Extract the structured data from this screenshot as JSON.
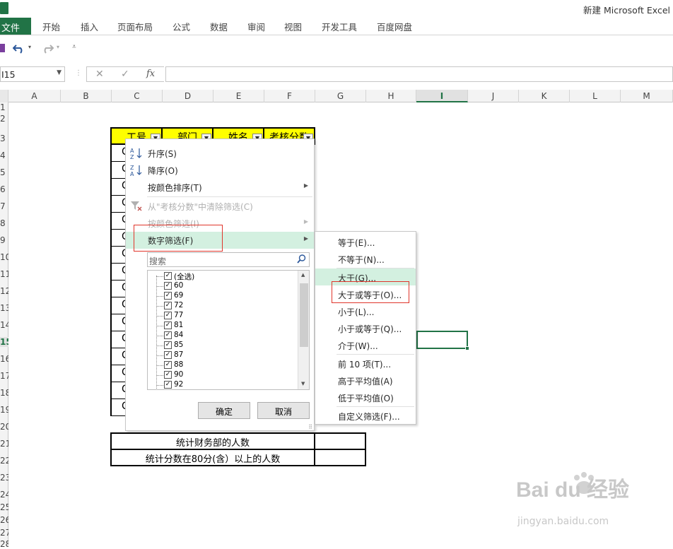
{
  "window": {
    "title": "新建 Microsoft Excel"
  },
  "ribbon": {
    "file_tab": "文件",
    "tabs": [
      "开始",
      "插入",
      "页面布局",
      "公式",
      "数据",
      "审阅",
      "视图",
      "开发工具",
      "百度网盘"
    ]
  },
  "formula_bar": {
    "name_box": "I15",
    "fx_label": "fx",
    "value": ""
  },
  "columns": [
    "A",
    "B",
    "C",
    "D",
    "E",
    "F",
    "G",
    "H",
    "I",
    "J",
    "K",
    "L",
    "M"
  ],
  "active_column": "I",
  "rows": [
    "1",
    "2",
    "3",
    "4",
    "5",
    "6",
    "7",
    "8",
    "9",
    "10",
    "11",
    "12",
    "13",
    "14",
    "15",
    "16",
    "17",
    "18",
    "19",
    "20",
    "21",
    "22",
    "23",
    "24",
    "25",
    "26",
    "27",
    "28"
  ],
  "active_row": "15",
  "table": {
    "headers": [
      "工号",
      "部门",
      "姓名",
      "考核分数"
    ],
    "first_col_values": [
      "C",
      "C",
      "C",
      "C",
      "C",
      "C",
      "C",
      "C",
      "C",
      "C",
      "C",
      "C",
      "C",
      "C",
      "C",
      "C"
    ]
  },
  "stats": {
    "rows": [
      {
        "label": "统计财务部的人数",
        "value": ""
      },
      {
        "label": "统计分数在80分(含）以上的人数",
        "value": ""
      }
    ]
  },
  "filter_menu": {
    "sort_asc": "升序(S)",
    "sort_desc": "降序(O)",
    "sort_by_color": "按颜色排序(T)",
    "clear_filter": "从\"考核分数\"中清除筛选(C)",
    "filter_by_color": "按颜色筛选(I)",
    "number_filters": "数字筛选(F)",
    "search_placeholder": "搜索",
    "select_all": "(全选)",
    "values": [
      "60",
      "69",
      "72",
      "77",
      "81",
      "84",
      "85",
      "87",
      "88",
      "90",
      "92"
    ],
    "ok": "确定",
    "cancel": "取消"
  },
  "number_filter_submenu": {
    "items": [
      "等于(E)...",
      "不等于(N)...",
      "大于(G)...",
      "大于或等于(O)...",
      "小于(L)...",
      "小于或等于(Q)...",
      "介于(W)...",
      "前 10 项(T)...",
      "高于平均值(A)",
      "低于平均值(O)",
      "自定义筛选(F)..."
    ],
    "highlighted": "大于(G)..."
  },
  "watermark": {
    "logo": "Bai du 经验",
    "url": "jingyan.baidu.com"
  },
  "colors": {
    "excel_green": "#217346",
    "header_fill": "#ffff00",
    "menu_highlight": "#d3f0e0",
    "annotation_red": "#e0352b"
  }
}
